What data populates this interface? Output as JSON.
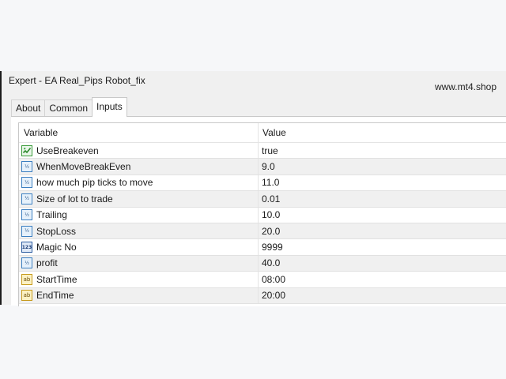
{
  "window": {
    "title": "Expert - EA Real_Pips Robot_fix",
    "watermark": "www.mt4.shop"
  },
  "tabs": [
    {
      "label": "About",
      "active": false
    },
    {
      "label": "Common",
      "active": false
    },
    {
      "label": "Inputs",
      "active": true
    }
  ],
  "table": {
    "columns": [
      "Variable",
      "Value"
    ],
    "rows": [
      {
        "icon": "bool-check-icon",
        "variable": "UseBreakeven",
        "value": "true"
      },
      {
        "icon": "double-type-icon",
        "variable": "WhenMoveBreakEven",
        "value": "9.0"
      },
      {
        "icon": "double-type-icon",
        "variable": "how much pip ticks to move",
        "value": "11.0"
      },
      {
        "icon": "double-type-icon",
        "variable": "Size of lot to trade",
        "value": "0.01"
      },
      {
        "icon": "double-type-icon",
        "variable": "Trailing",
        "value": "10.0"
      },
      {
        "icon": "double-type-icon",
        "variable": "StopLoss",
        "value": "20.0"
      },
      {
        "icon": "int-type-icon",
        "variable": "Magic No",
        "value": "9999"
      },
      {
        "icon": "double-type-icon",
        "variable": "profit",
        "value": "40.0"
      },
      {
        "icon": "string-type-icon",
        "variable": "StartTime",
        "value": "08:00"
      },
      {
        "icon": "string-type-icon",
        "variable": "EndTime",
        "value": "20:00"
      }
    ]
  }
}
